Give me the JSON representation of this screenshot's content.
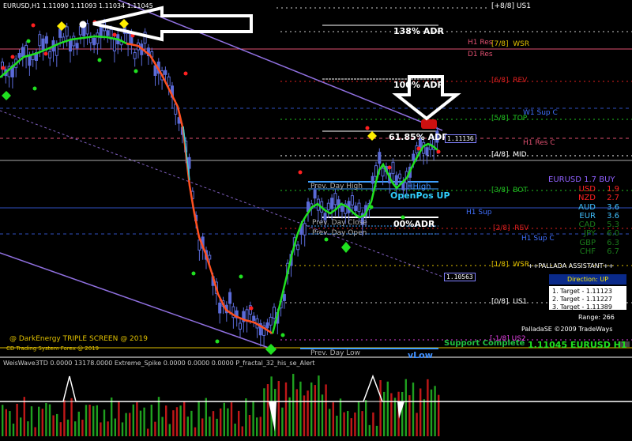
{
  "window": {
    "symbol_header": "EURUSD,H1",
    "ohlc": "1.11090 1.11093 1.11034 1.11045"
  },
  "murrey_levels": [
    {
      "label": "[+8/8] US1",
      "color": "#ffffff"
    },
    {
      "label": "[7/8]  WSR",
      "color": "#e0c000"
    },
    {
      "label": "[6/8]  REV",
      "color": "#e02020"
    },
    {
      "label": "[5/8]  TOP",
      "color": "#22c422"
    },
    {
      "label": "[4/8]  MID",
      "color": "#ffffff"
    },
    {
      "label": "[3/8]  BOT",
      "color": "#22c422"
    },
    {
      "label": "[2/8]  REV",
      "color": "#e02020"
    },
    {
      "label": "[1/8]  WSR",
      "color": "#e0c000"
    },
    {
      "label": "[0/8]  US1",
      "color": "#ffffff"
    },
    {
      "label": "[-1/8] US2",
      "color": "#e040e0"
    }
  ],
  "pivot_labels": {
    "h1_res": "H1 Res",
    "d1_res": "D1 Res",
    "w1_sup": "W1 Sup C",
    "h1_res_c": "H1 Res C",
    "h1_sup": "H1 Sup",
    "h1_sup_c": "H1 Sup C"
  },
  "adr_labels": {
    "adr138": "138% ADR",
    "adr100": "100% ADR",
    "adr61": "61.85% ADR",
    "adr0": "00%ADR"
  },
  "day_labels": {
    "prev_day_high": "Prev. Day High",
    "prev_day_close": "Prev. Day Close",
    "prev_day_open": "Prev. Day Open",
    "prev_day_low": "Prev. Day Low",
    "hhigh": "HHigh",
    "vlow": "vLow",
    "openpos": "OpenPos  UP",
    "support_complete": "Support Complete"
  },
  "price_tags": {
    "upper": "1.11136",
    "lower": "1.10563"
  },
  "palladas": {
    "title": "EURUSD 1.7 BUY",
    "currencies": [
      {
        "name": "USD",
        "value": "1.9",
        "color": "#ff2020"
      },
      {
        "name": "NZD",
        "value": "2.7",
        "color": "#ff2020"
      },
      {
        "name": "AUD",
        "value": "3.6",
        "color": "#40c0ff"
      },
      {
        "name": "EUR",
        "value": "3.6",
        "color": "#40c0ff"
      },
      {
        "name": "CAD",
        "value": "5.3",
        "color": "#1a7a1a"
      },
      {
        "name": "JPY",
        "value": "6.0",
        "color": "#1a7a1a"
      },
      {
        "name": "GBP",
        "value": "6.3",
        "color": "#1a7a1a"
      },
      {
        "name": "CHF",
        "value": "6.7",
        "color": "#1a7a1a"
      }
    ],
    "assistant": "++PALLADA ASSISTANT++",
    "direction": "Direction: UP",
    "targets": [
      "1. Target - 1.11123",
      "2. Target - 1.11227",
      "3. Target - 1.11389"
    ],
    "range": "Range: 266",
    "copyright": "PalladaSE ©2009 TradeWays",
    "big_label": "1.11045 EURUSD H1"
  },
  "footer": {
    "dark_energy": "@ DarkEnergy TRIPLE SCREEN @ 2019",
    "system": "CD Trading System Forex @ 2019"
  },
  "subwindow": {
    "header": "WeisWave3TD 0.0000 13178.0000 Extreme_Spike 0.0000 0.0000 0.0000 P_fractal_32_his_se_Alert"
  }
}
